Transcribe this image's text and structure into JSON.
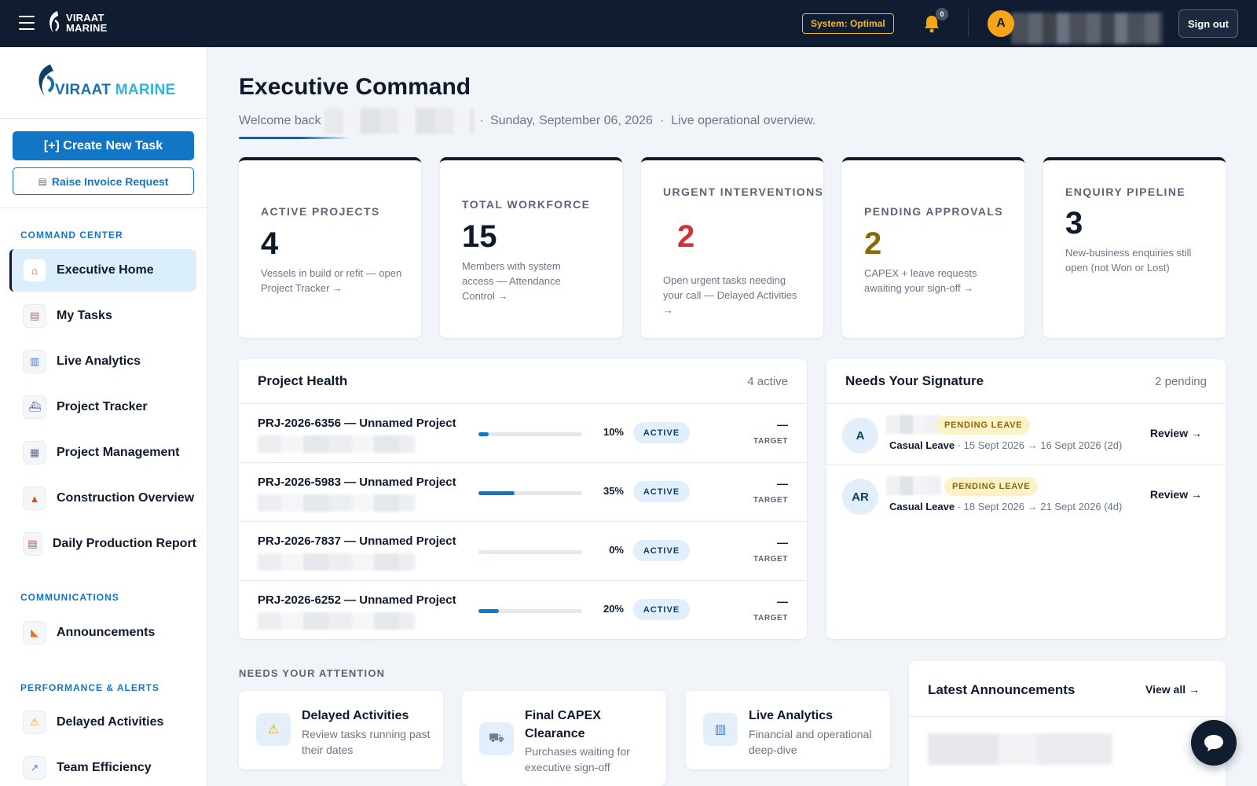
{
  "topbar": {
    "logo_line1": "VIRAAT",
    "logo_line2": "MARINE",
    "system_status": "System: Optimal",
    "notification_count": "0",
    "user_initial": "A",
    "sign_out": "Sign out"
  },
  "sidebar": {
    "logo_word1": "VIRAAT",
    "logo_word2": "MARINE",
    "create_task": "[+] Create New Task",
    "raise_invoice": "Raise Invoice Request",
    "sections": {
      "command_center": "COMMAND CENTER",
      "communications": "COMMUNICATIONS",
      "performance": "PERFORMANCE & ALERTS"
    },
    "items": [
      {
        "label": "Executive Home",
        "icon": "home-icon"
      },
      {
        "label": "My Tasks",
        "icon": "tasks-icon"
      },
      {
        "label": "Live Analytics",
        "icon": "chart-icon"
      },
      {
        "label": "Project Tracker",
        "icon": "ship-icon"
      },
      {
        "label": "Project Management",
        "icon": "building-icon"
      },
      {
        "label": "Construction Overview",
        "icon": "construction-icon"
      },
      {
        "label": "Daily Production Report",
        "icon": "report-icon"
      },
      {
        "label": "Announcements",
        "icon": "megaphone-icon"
      },
      {
        "label": "Delayed Activities",
        "icon": "warning-icon"
      },
      {
        "label": "Team Efficiency",
        "icon": "trend-icon"
      }
    ]
  },
  "header": {
    "title": "Executive Command",
    "welcome": "Welcome back",
    "separator": "·",
    "date": "Sunday, September 06, 2026",
    "overview": "Live operational overview."
  },
  "kpis": [
    {
      "label": "ACTIVE PROJECTS",
      "value": "4",
      "desc": "Vessels in build or refit — open Project Tracker →",
      "color": "#0f1b2d"
    },
    {
      "label": "TOTAL WORKFORCE",
      "value": "15",
      "desc": "Members with system access — Attendance Control →",
      "color": "#0f1b2d"
    },
    {
      "label": "URGENT INTERVENTIONS",
      "value": "2",
      "desc": "Open urgent tasks needing your call — Delayed Activities →",
      "color": "#d32f3a"
    },
    {
      "label": "PENDING APPROVALS",
      "value": "2",
      "desc": "CAPEX + leave requests awaiting your sign-off →",
      "color": "#8a6a06"
    },
    {
      "label": "ENQUIRY PIPELINE",
      "value": "3",
      "desc": "New-business enquiries still open (not Won or Lost)",
      "color": "#0f1b2d"
    }
  ],
  "project_health": {
    "title": "Project Health",
    "meta": "4 active",
    "rows": [
      {
        "name": "PRJ-2026-6356 — Unnamed Project",
        "progress": 10,
        "pct_label": "10%",
        "status": "ACTIVE",
        "target": "—",
        "target_label": "TARGET"
      },
      {
        "name": "PRJ-2026-5983 — Unnamed Project",
        "progress": 35,
        "pct_label": "35%",
        "status": "ACTIVE",
        "target": "—",
        "target_label": "TARGET"
      },
      {
        "name": "PRJ-2026-7837 — Unnamed Project",
        "progress": 0,
        "pct_label": "0%",
        "status": "ACTIVE",
        "target": "—",
        "target_label": "TARGET"
      },
      {
        "name": "PRJ-2026-6252 — Unnamed Project",
        "progress": 20,
        "pct_label": "20%",
        "status": "ACTIVE",
        "target": "—",
        "target_label": "TARGET"
      }
    ]
  },
  "signatures": {
    "title": "Needs Your Signature",
    "meta": "2 pending",
    "rows": [
      {
        "initials": "A",
        "status": "PENDING LEAVE",
        "type": "Casual Leave",
        "detail": " · 15 Sept 2026 → 16 Sept 2026 (2d)",
        "action": "Review →"
      },
      {
        "initials": "AR",
        "status": "PENDING LEAVE",
        "type": "Casual Leave",
        "detail": " · 18 Sept 2026 → 21 Sept 2026 (4d)",
        "action": "Review →"
      }
    ]
  },
  "attention": {
    "label": "NEEDS YOUR ATTENTION",
    "cards": [
      {
        "title": "Delayed Activities",
        "desc": "Review tasks running past their dates",
        "icon": "warning-icon"
      },
      {
        "title": "Final CAPEX Clearance",
        "desc": "Purchases waiting for executive sign-off",
        "icon": "cart-icon"
      },
      {
        "title": "Live Analytics",
        "desc": "Financial and operational deep-dive",
        "icon": "chart-icon"
      }
    ]
  },
  "announcements": {
    "title": "Latest Announcements",
    "view_all": "View all →"
  },
  "colors": {
    "navy": "#101d30",
    "accent_blue": "#1276c7",
    "warning_amber": "#f5b82e",
    "urgent_red": "#d32f3a"
  }
}
